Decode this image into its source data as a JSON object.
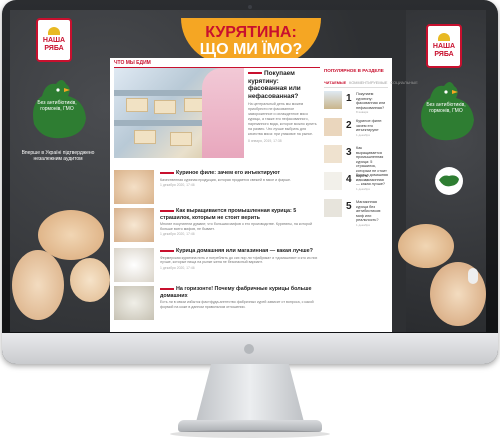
{
  "brand": {
    "logo_line1": "НАША",
    "logo_line2": "РЯБА"
  },
  "banner": {
    "line1": "КУРЯТИНА:",
    "line2": "ЩО МИ ЇМО?"
  },
  "hero_badges": {
    "left": "Без антибіотиків, гормонів, ГМО",
    "left_sub": "Вперше в Україні підтверджено незалежним аудитом",
    "right": "Без антибіотиків, гормонів, ГМО"
  },
  "content": {
    "section_title": "ЧТО МЫ ЕДИМ",
    "featured": {
      "title": "Покупаем курятину: фасованная или нефасованная?",
      "desc": "На центральный день мы можем приобрести не фасованное замороженное и охлажденное мясо курицы, а также его нефасованного, нарезанного вида, которое можно купить на развес. Что лучше выбрать для качества мяса: при упаковке на рынке.",
      "date": "8 января, 2019, 17:38"
    },
    "articles": [
      {
        "title": "Куриное филе: зачем его инъектируют",
        "desc": "Качественная куриная продукция, которая продается свежей в мясе и фарше.",
        "date": "1 декабря 2020, 17:46"
      },
      {
        "title": "Как выращивается промышленная курица: 5 страшилок, которым не стоит верить",
        "desc": "Многие покупатели думают, что большая мифов о его производстве. Курятины, на которой больше всего мифов, не бывает.",
        "date": "1 декабря 2020, 17:46"
      },
      {
        "title": "Курица домашняя или магазинная — какая лучше?",
        "desc": "Фермерская курятина пить и потреблять до сих пор ли «фабрика» и «домашняя» и кто из них лучше, которые пища на рынке жена не безопасный вариант.",
        "date": "1 декабря 2020, 17:46"
      },
      {
        "title": "На горизонте! Почему фабричные курицы больше домашних",
        "desc": "Есть ли в связи избыток фастфуда-агентство фабричных курей зависит от вопроса, с какой формой на коже в данном правильном отношении.",
        "date": ""
      }
    ]
  },
  "sidebar": {
    "title": "ПОПУЛЯРНОЕ В РАЗДЕЛЕ",
    "tabs": [
      "ЧИТАЕМЫЕ",
      "КОММЕНТИРУЕМЫЕ",
      "СОЦИАЛЬНЫЕ"
    ],
    "items": [
      {
        "num": "1",
        "title": "Покупаем курятину: фасованная или нефасованная?",
        "date": "8 января"
      },
      {
        "num": "2",
        "title": "Куриное филе: зачем его инъектируют",
        "date": "1 декабря"
      },
      {
        "num": "3",
        "title": "Как выращивается промышленная курица: 5 страшилок, которым не стоит верить",
        "date": "1 декабря"
      },
      {
        "num": "4",
        "title": "Курица домашняя или магазинная — какая лучше?",
        "date": "1 декабря"
      },
      {
        "num": "5",
        "title": "Магазинная курица без антибиотиков: миф или реальность?",
        "date": "1 декабря"
      }
    ]
  },
  "colors": {
    "accent": "#c8102e",
    "banner": "#f5a623",
    "hen": "#2e7d32"
  }
}
